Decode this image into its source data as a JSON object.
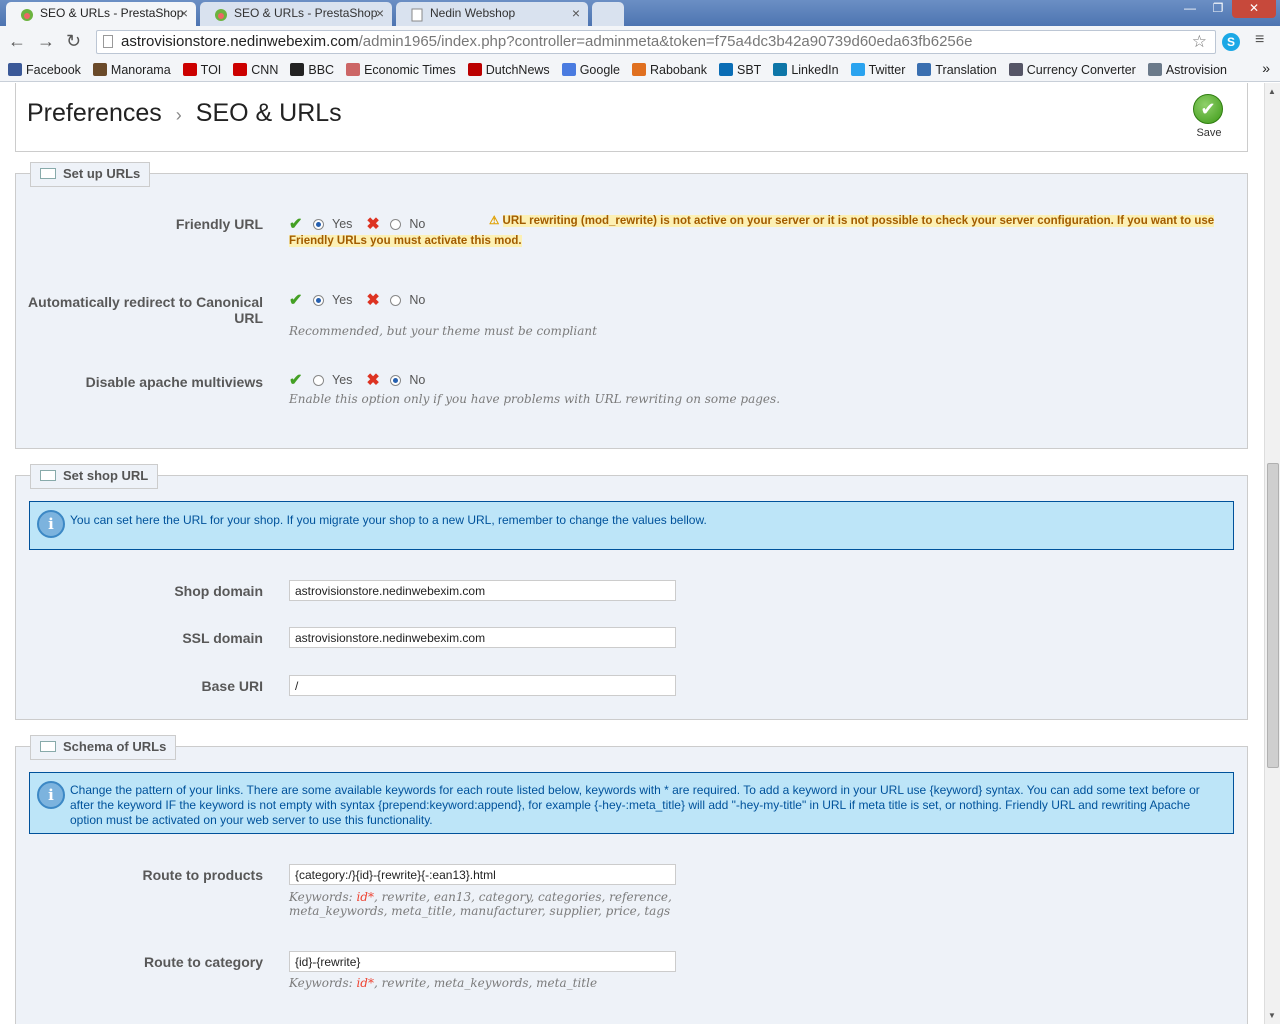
{
  "browser": {
    "tabs": [
      {
        "title": "SEO & URLs - PrestaShop",
        "active": true
      },
      {
        "title": "SEO & URLs - PrestaShop",
        "active": false
      },
      {
        "title": "Nedin Webshop",
        "active": false
      }
    ],
    "address": {
      "host": "astrovisionstore.nedinwebexim.com",
      "path": "/admin1965/index.php?controller=adminmeta&token=f75a4dc3b42a90739d60eda63fb6256e"
    },
    "bookmarks": [
      "Facebook",
      "Manorama",
      "TOI",
      "CNN",
      "BBC",
      "Economic Times",
      "DutchNews",
      "Google",
      "Rabobank",
      "SBT",
      "LinkedIn",
      "Twitter",
      "Translation",
      "Currency Converter",
      "Astrovision"
    ],
    "bookmark_colors": [
      "#3b5998",
      "#6a4a2a",
      "#c00",
      "#c00",
      "#222",
      "#c66",
      "#b00",
      "#4a7be0",
      "#e07020",
      "#0a6db5",
      "#0e76a8",
      "#2aa3ef",
      "#3a6fb0",
      "#556",
      "#6b7a8a"
    ]
  },
  "header": {
    "breadcrumb_parent": "Preferences",
    "breadcrumb_separator": "›",
    "title": "SEO & URLs",
    "save_label": "Save"
  },
  "setup_urls": {
    "legend": "Set up URLs",
    "friendly_url": {
      "label": "Friendly URL",
      "yes": "Yes",
      "no": "No",
      "selected": "yes",
      "warning": "URL rewriting (mod_rewrite) is not active on your server or it is not possible to check your server configuration. If you want to use Friendly URLs you must activate this mod."
    },
    "canonical": {
      "label": "Automatically redirect to Canonical URL",
      "yes": "Yes",
      "no": "No",
      "selected": "yes",
      "hint": "Recommended, but your theme must be compliant"
    },
    "multiviews": {
      "label": "Disable apache multiviews",
      "yes": "Yes",
      "no": "No",
      "selected": "no",
      "hint": "Enable this option only if you have problems with URL rewriting on some pages."
    }
  },
  "shop_url": {
    "legend": "Set shop URL",
    "info": "You can set here the URL for your shop. If you migrate your shop to a new URL, remember to change the values bellow.",
    "shop_domain": {
      "label": "Shop domain",
      "value": "astrovisionstore.nedinwebexim.com"
    },
    "ssl_domain": {
      "label": "SSL domain",
      "value": "astrovisionstore.nedinwebexim.com"
    },
    "base_uri": {
      "label": "Base URI",
      "value": "/"
    }
  },
  "schema": {
    "legend": "Schema of URLs",
    "info": "Change the pattern of your links. There are some available keywords for each route listed below, keywords with * are required. To add a keyword in your URL use {keyword} syntax. You can add some text before or after the keyword IF the keyword is not empty with syntax {prepend:keyword:append}, for example {-hey-:meta_title} will add \"-hey-my-title\" in URL if meta title is set, or nothing. Friendly URL and rewriting Apache option must be activated on your web server to use this functionality.",
    "products": {
      "label": "Route to products",
      "value": "{category:/}{id}-{rewrite}{-:ean13}.html",
      "kw_prefix": "Keywords:",
      "kw_req": "id*",
      "kw_rest": ", rewrite, ean13, category, categories, reference, meta_keywords, meta_title, manufacturer, supplier, price, tags"
    },
    "category": {
      "label": "Route to category",
      "value": "{id}-{rewrite}",
      "kw_prefix": "Keywords:",
      "kw_req": "id*",
      "kw_rest": ", rewrite, meta_keywords, meta_title"
    }
  }
}
